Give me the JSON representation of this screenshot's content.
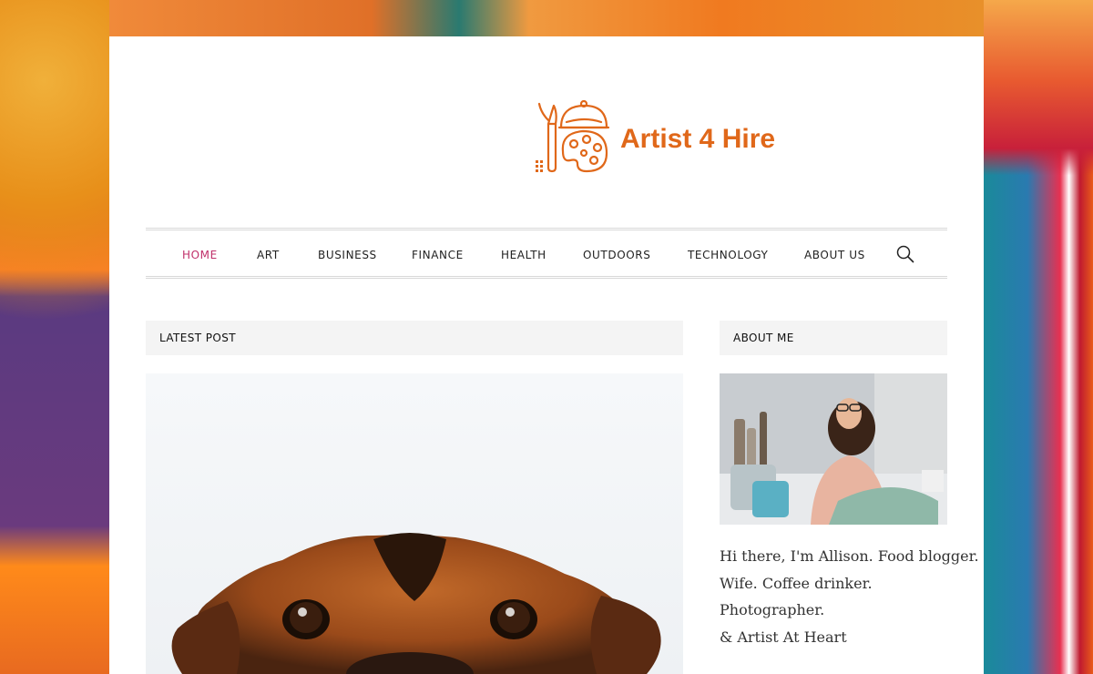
{
  "site": {
    "name": "Artist 4 Hire"
  },
  "nav": {
    "items": [
      {
        "label": "HOME",
        "active": true
      },
      {
        "label": "ART",
        "active": false
      },
      {
        "label": "BUSINESS",
        "active": false
      },
      {
        "label": "FINANCE",
        "active": false
      },
      {
        "label": "HEALTH",
        "active": false
      },
      {
        "label": "OUTDOORS",
        "active": false
      },
      {
        "label": "TECHNOLOGY",
        "active": false
      },
      {
        "label": "ABOUT US",
        "active": false
      }
    ],
    "search_icon": "search-icon"
  },
  "main": {
    "section_title": "LATEST POST",
    "post_image": "dog-photo"
  },
  "sidebar": {
    "section_title": "ABOUT ME",
    "about_image": "artist-photo",
    "about_lines": [
      "Hi there, I'm Allison. Food blogger.",
      "Wife. Coffee drinker.",
      "Photographer.",
      "& Artist At Heart"
    ]
  },
  "colors": {
    "accent": "#e0681a",
    "nav_active": "#c0306a",
    "section_bg": "#f4f4f4"
  }
}
